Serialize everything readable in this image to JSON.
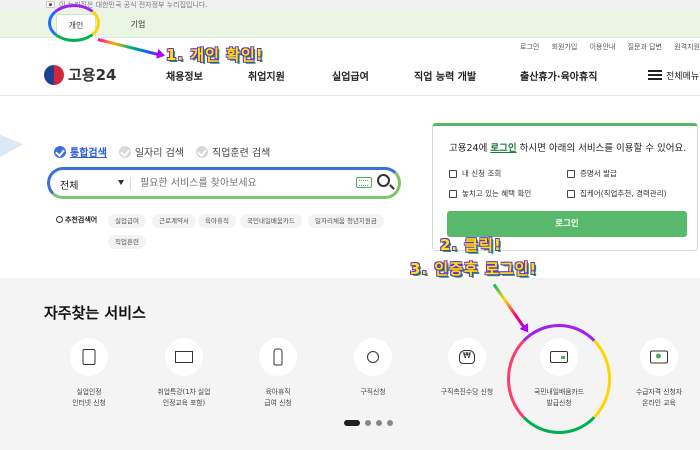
{
  "gov_banner": {
    "text": "이 누리집은 대한민국 공식 전자정부 누리집입니다."
  },
  "tabs": {
    "personal": "개인",
    "corporate": "기업"
  },
  "annotations": {
    "step1": "1. 개인 확인!",
    "step2": "2. 클릭!",
    "step3": "3. 인증후 로그인!"
  },
  "utility_links": [
    "로그인",
    "회원가입",
    "이용안내",
    "질문과 답변",
    "원격지원"
  ],
  "logo": {
    "name": "고용24"
  },
  "nav": {
    "items": [
      "채용정보",
      "취업지원",
      "실업급여",
      "직업 능력 개발",
      "출산휴가·육아휴직"
    ],
    "menu_all": "전체메뉴"
  },
  "search": {
    "tabs": [
      {
        "label": "통합검색",
        "active": true
      },
      {
        "label": "일자리 검색",
        "active": false
      },
      {
        "label": "직업훈련 검색",
        "active": false
      }
    ],
    "select_value": "전체",
    "placeholder": "필요한 서비스를 찾아보세요",
    "recommended_label": "추천검색어",
    "chips": [
      "실업급여",
      "근로계약서",
      "육아휴직",
      "국민내일배움카드",
      "일자리채움 청년지원금",
      "직업훈련"
    ]
  },
  "login_panel": {
    "title_pre": "고용24에 ",
    "title_highlight": "로그인",
    "title_post": " 하시면 아래의 서비스를 이용할 수 있어요.",
    "services": [
      "내 신청 조회",
      "증명서 발급",
      "놓치고 있는 혜택 확인",
      "집케어(직업추천, 경력관리)"
    ],
    "button": "로그인"
  },
  "frequent_services": {
    "heading": "자주찾는 서비스",
    "items": [
      {
        "line1": "실업인정",
        "line2": "인터넷 신청",
        "icon": "document-pen-icon"
      },
      {
        "line1": "취업특강(1차 실업",
        "line2": "인정교육 포함)",
        "icon": "whiteboard-icon"
      },
      {
        "line1": "육아휴직",
        "line2": "급여 신청",
        "icon": "baby-bottle-icon"
      },
      {
        "line1": "구직신청",
        "line2": "",
        "icon": "person-edit-icon"
      },
      {
        "line1": "구직촉진수당 신청",
        "line2": "",
        "icon": "money-bag-icon"
      },
      {
        "line1": "국민내일배움카드",
        "line2": "발급신청",
        "icon": "card-icon"
      },
      {
        "line1": "수급자격 신청자",
        "line2": "온라인 교육",
        "icon": "monitor-play-icon"
      }
    ]
  },
  "colors": {
    "accent_green": "#58b86c",
    "accent_blue": "#3a6fe0",
    "annotation_yellow": "#ffe600"
  }
}
